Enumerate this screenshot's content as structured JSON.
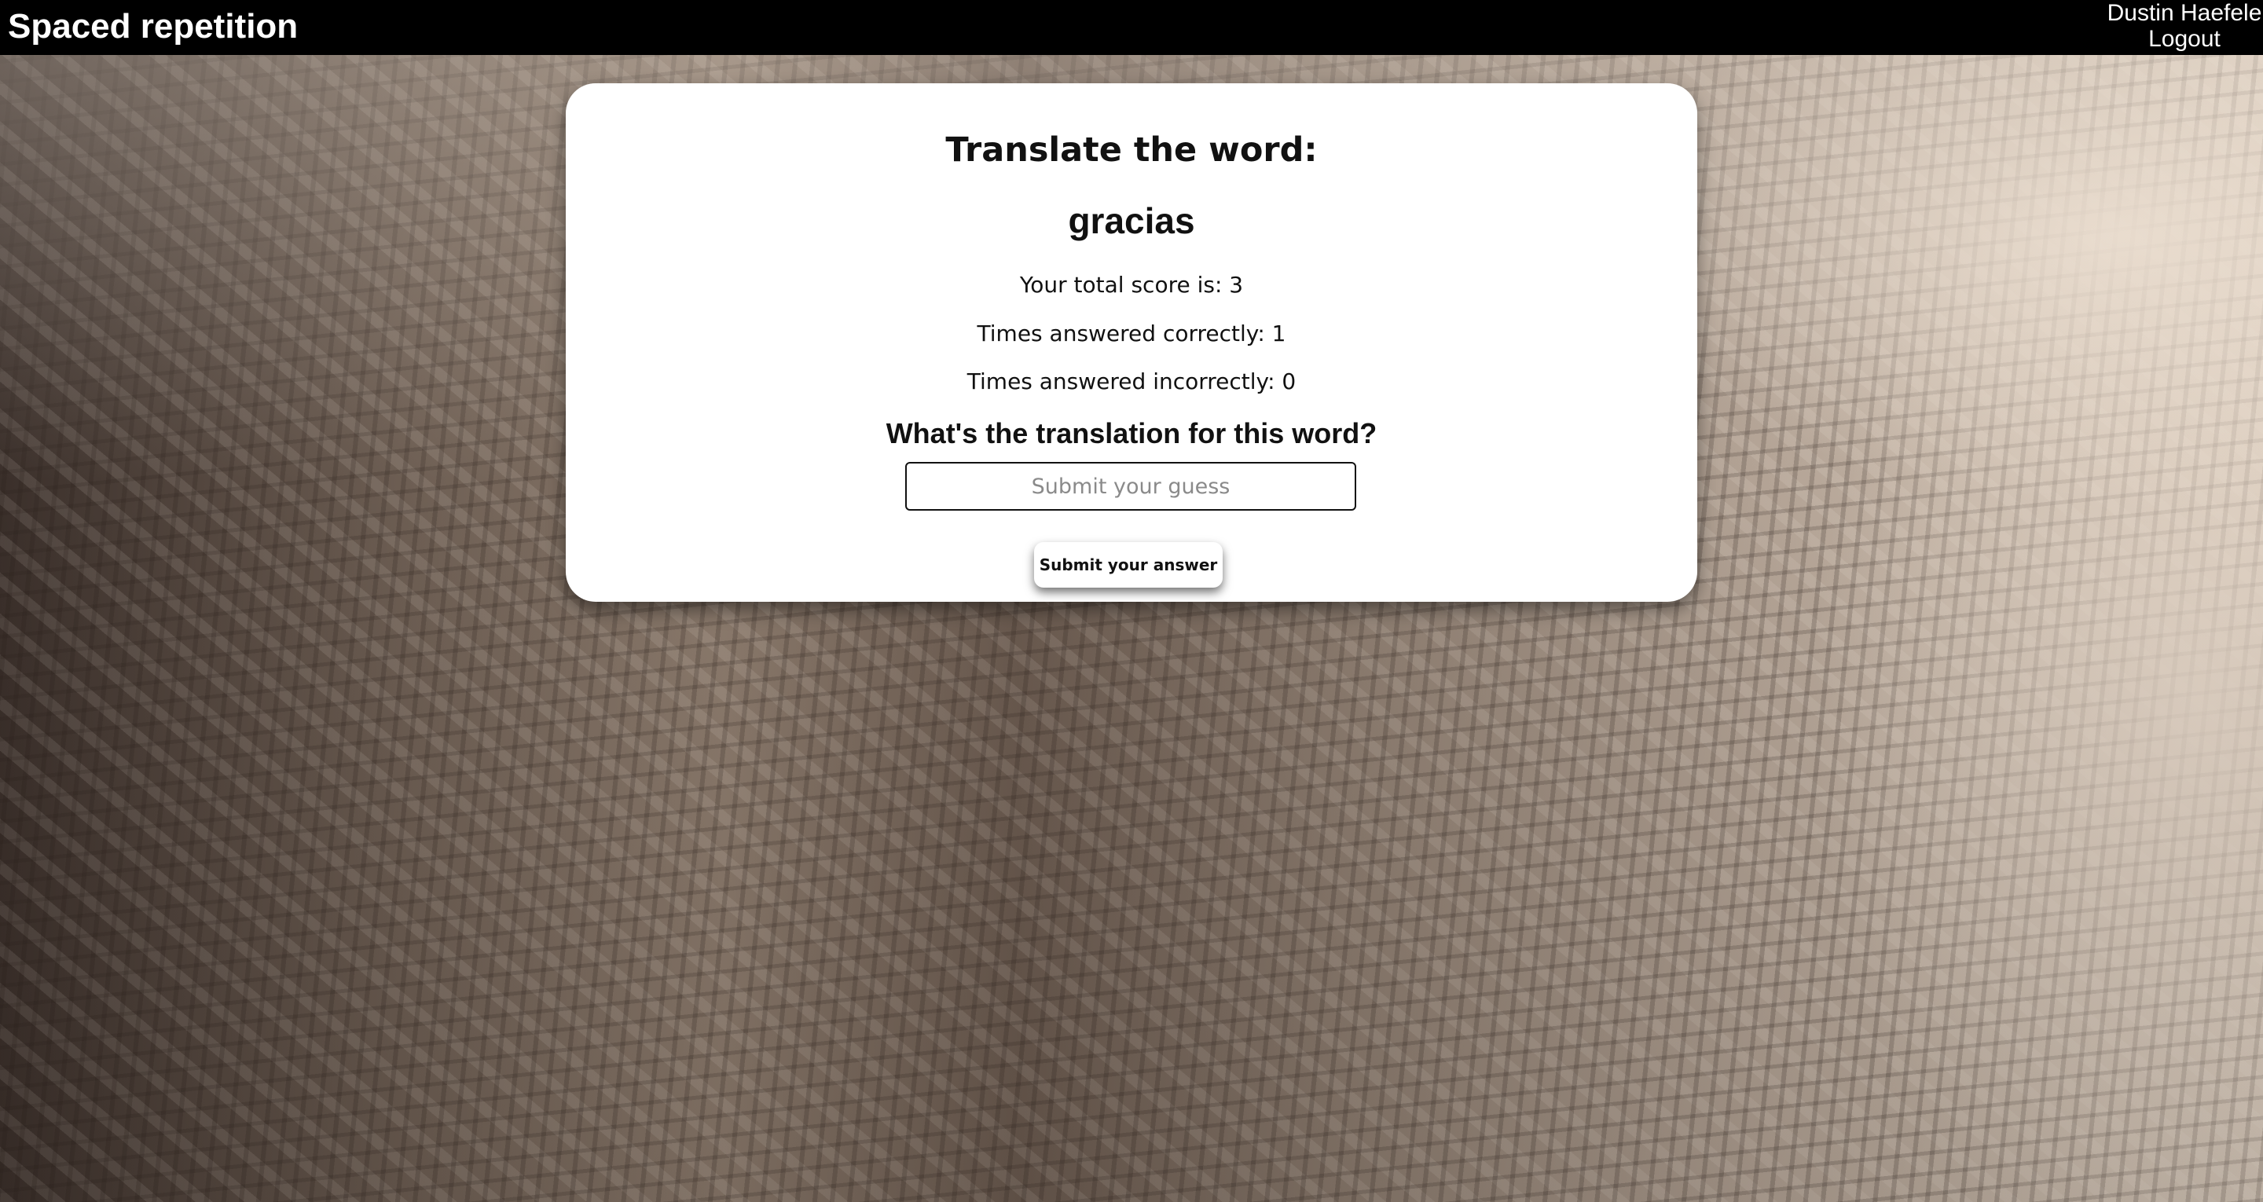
{
  "header": {
    "app_title": "Spaced repetition",
    "user_name": "Dustin Haefele",
    "logout_label": "Logout"
  },
  "card": {
    "heading": "Translate the word:",
    "word": "gracias",
    "total_score_text": "Your total score is: 3",
    "correct_count_text": "Times answered correctly: 1",
    "incorrect_count_text": "Times answered incorrectly: 0",
    "question": "What's the translation for this word?",
    "guess_input": {
      "value": "",
      "placeholder": "Submit your guess"
    },
    "submit_label": "Submit your answer"
  },
  "colors": {
    "header_background": "#000000",
    "header_text": "#ffffff",
    "card_background": "#ffffff",
    "text": "#111111"
  }
}
